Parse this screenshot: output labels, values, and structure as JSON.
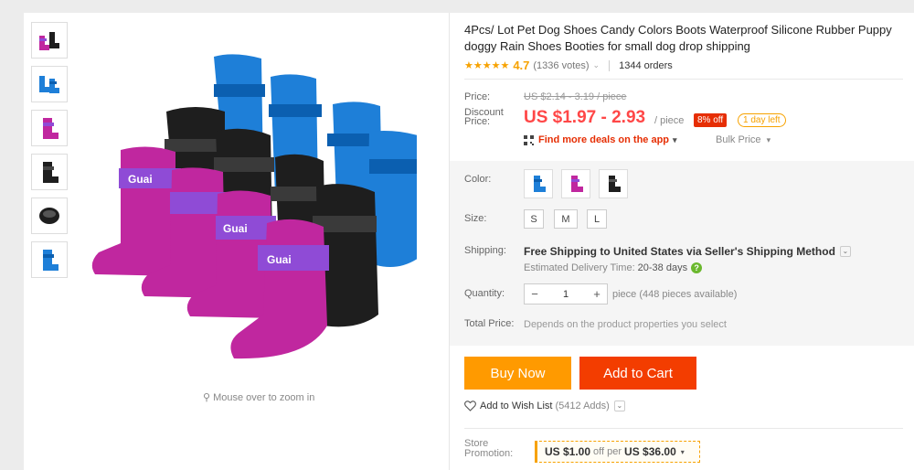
{
  "product": {
    "title": "4Pcs/ Lot Pet Dog Shoes Candy Colors Boots Waterproof Silicone Rubber Puppy doggy Rain Shoes Booties for small dog drop shipping",
    "rating": {
      "stars": "★★★★★",
      "score": "4.7",
      "votes": "(1336 votes)",
      "orders": "1344 orders"
    },
    "zoom_hint": "Mouse over to zoom in",
    "thumbnails": [
      "pink-black-shoes",
      "blue-shoes",
      "pink-shoe",
      "black-shoe",
      "black-shoe-top",
      "blue-shoe"
    ],
    "image_text": "Guai"
  },
  "pricing": {
    "price_label": "Price:",
    "original_price": "US $2.14 - 3.19 / piece",
    "discount_label_1": "Discount",
    "discount_label_2": "Price:",
    "discount_price": "US $1.97 - 2.93",
    "per_piece": "/ piece",
    "discount_badge": "8% off",
    "days_left": "1 day left",
    "deals_text": "Find more deals on the app",
    "deals_chevron": "▾",
    "bulk_price": "Bulk Price",
    "bulk_chevron": "▾"
  },
  "properties": {
    "color_label": "Color:",
    "colors": [
      "blue",
      "purple",
      "black"
    ],
    "size_label": "Size:",
    "sizes": [
      "S",
      "M",
      "L"
    ],
    "shipping_label": "Shipping:",
    "shipping_text": "Free Shipping to United States via Seller's Shipping Method",
    "shipping_chevron": "⌄",
    "delivery_label": "Estimated Delivery Time:",
    "delivery_days": "20-38 days",
    "help_icon": "?",
    "quantity_label": "Quantity:",
    "quantity_value": "1",
    "qty_minus": "−",
    "qty_plus": "+",
    "availability": "piece (448 pieces available)",
    "total_label": "Total Price:",
    "total_text": "Depends on the product properties you select"
  },
  "actions": {
    "buy_now": "Buy Now",
    "add_to_cart": "Add to Cart",
    "wishlist": "Add to Wish List",
    "wishlist_count": "(5412 Adds)",
    "wishlist_chevron": "⌄"
  },
  "promotion": {
    "label_1": "Store",
    "label_2": "Promotion:",
    "amount": "US $1.00",
    "middle": "off per",
    "threshold": "US $36.00",
    "chevron": "▾"
  },
  "colors": {
    "accent_red": "#ff4747",
    "buy_now_orange": "#ff9a00",
    "cart_red": "#f33d00",
    "star_gold": "#f7a200",
    "shoe_pink": "#c0279f",
    "shoe_blue": "#1e7fd8",
    "shoe_black": "#1e1e1e",
    "strap_purple": "#8f4bd6"
  }
}
